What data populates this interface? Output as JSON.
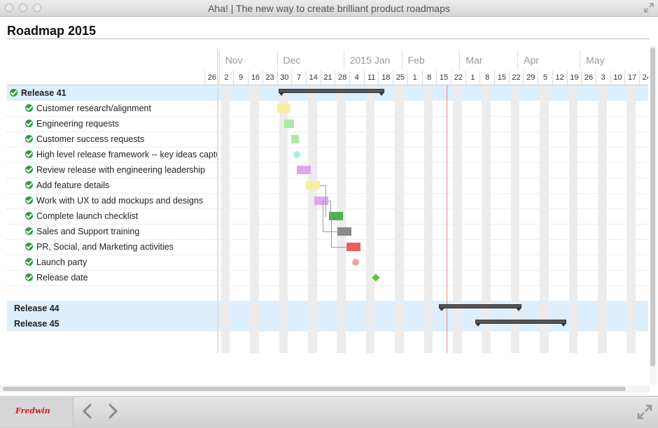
{
  "window": {
    "title": "Aha! | The new way to create brilliant product roadmaps",
    "close_icon": "close-icon",
    "fullscreen_icon": "fullscreen-icon"
  },
  "page": {
    "title": "Roadmap 2015"
  },
  "timeline": {
    "months": [
      "Nov",
      "Dec",
      "2015 Jan",
      "Feb",
      "Mar",
      "Apr",
      "May"
    ],
    "weeks": [
      "26",
      "2",
      "9",
      "16",
      "23",
      "30",
      "7",
      "14",
      "21",
      "28",
      "4",
      "11",
      "18",
      "25",
      "1",
      "8",
      "15",
      "22",
      "1",
      "8",
      "15",
      "22",
      "29",
      "5",
      "12",
      "19",
      "26",
      "3",
      "10",
      "17",
      "24"
    ]
  },
  "rows": [
    {
      "label": "Release 41",
      "type": "release",
      "checked": true
    },
    {
      "label": "Customer research/alignment",
      "type": "feature",
      "checked": true
    },
    {
      "label": "Engineering requests",
      "type": "feature",
      "checked": true
    },
    {
      "label": "Customer success requests",
      "type": "feature",
      "checked": true
    },
    {
      "label": "High level release framework -- key ideas captured",
      "type": "feature",
      "checked": true
    },
    {
      "label": "Review release with engineering leadership",
      "type": "feature",
      "checked": true
    },
    {
      "label": "Add feature details",
      "type": "feature",
      "checked": true
    },
    {
      "label": "Work with UX to add mockups and designs",
      "type": "feature",
      "checked": true
    },
    {
      "label": "Complete launch checklist",
      "type": "feature",
      "checked": true
    },
    {
      "label": "Sales and Support training",
      "type": "feature",
      "checked": true
    },
    {
      "label": "PR, Social, and Marketing activities",
      "type": "feature",
      "checked": true
    },
    {
      "label": "Launch party",
      "type": "feature",
      "checked": true
    },
    {
      "label": "Release date",
      "type": "feature",
      "checked": true
    },
    {
      "label": "",
      "type": "spacer",
      "checked": false
    },
    {
      "label": "Release 44",
      "type": "release",
      "checked": false
    },
    {
      "label": "Release 45",
      "type": "release",
      "checked": false
    }
  ],
  "colors": {
    "release_band": "#ddeefc",
    "release_bar": "#555555",
    "check": "#2e9e3c",
    "today": "#e88a8a",
    "yellow": "#fbeea0",
    "green_light": "#a9ec9c",
    "cyan": "#a8f0e8",
    "purple": "#d9a8f0",
    "green_dark": "#4cb050",
    "gray": "#8a8a8a",
    "red": "#ef5a5a",
    "pink": "#f4a0a8",
    "diamond": "#6cbf3a"
  },
  "bottom_bar": {
    "logo": "Fredwin",
    "back_icon": "chevron-left-icon",
    "forward_icon": "chevron-right-icon",
    "expand_icon": "expand-icon"
  }
}
